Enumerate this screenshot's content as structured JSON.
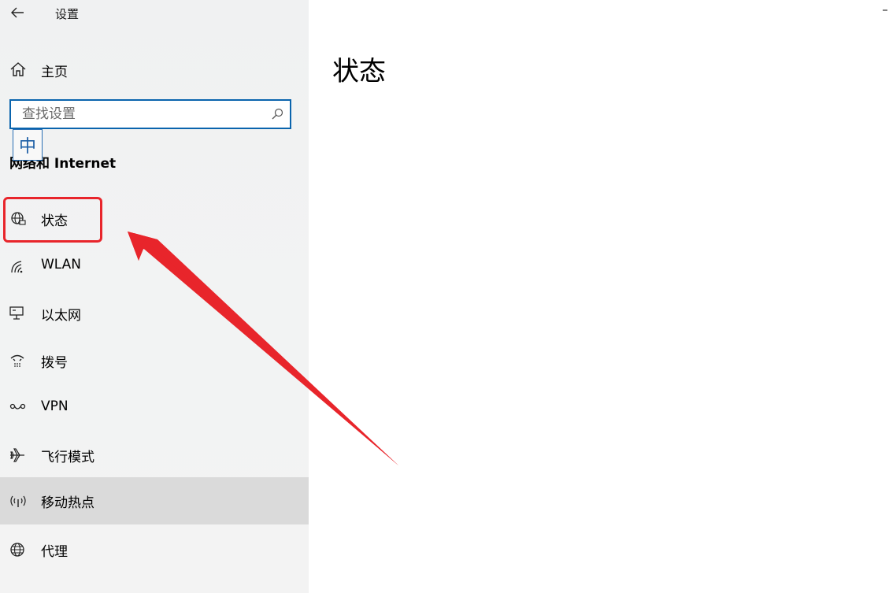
{
  "window": {
    "title": "设置"
  },
  "sidebar": {
    "home_label": "主页",
    "search_placeholder": "查找设置",
    "section_title": "网络和 Internet",
    "items": [
      {
        "label": "状态",
        "icon": "globe-status-icon"
      },
      {
        "label": "WLAN",
        "icon": "wifi-icon"
      },
      {
        "label": "以太网",
        "icon": "ethernet-icon"
      },
      {
        "label": "拨号",
        "icon": "dialup-icon"
      },
      {
        "label": "VPN",
        "icon": "vpn-icon"
      },
      {
        "label": "飞行模式",
        "icon": "airplane-icon"
      },
      {
        "label": "移动热点",
        "icon": "hotspot-icon"
      },
      {
        "label": "代理",
        "icon": "globe-proxy-icon"
      }
    ]
  },
  "ime": {
    "label": "中"
  },
  "main": {
    "title": "状态"
  },
  "colors": {
    "accent": "#0a64ad",
    "annotation": "#e8252b"
  }
}
